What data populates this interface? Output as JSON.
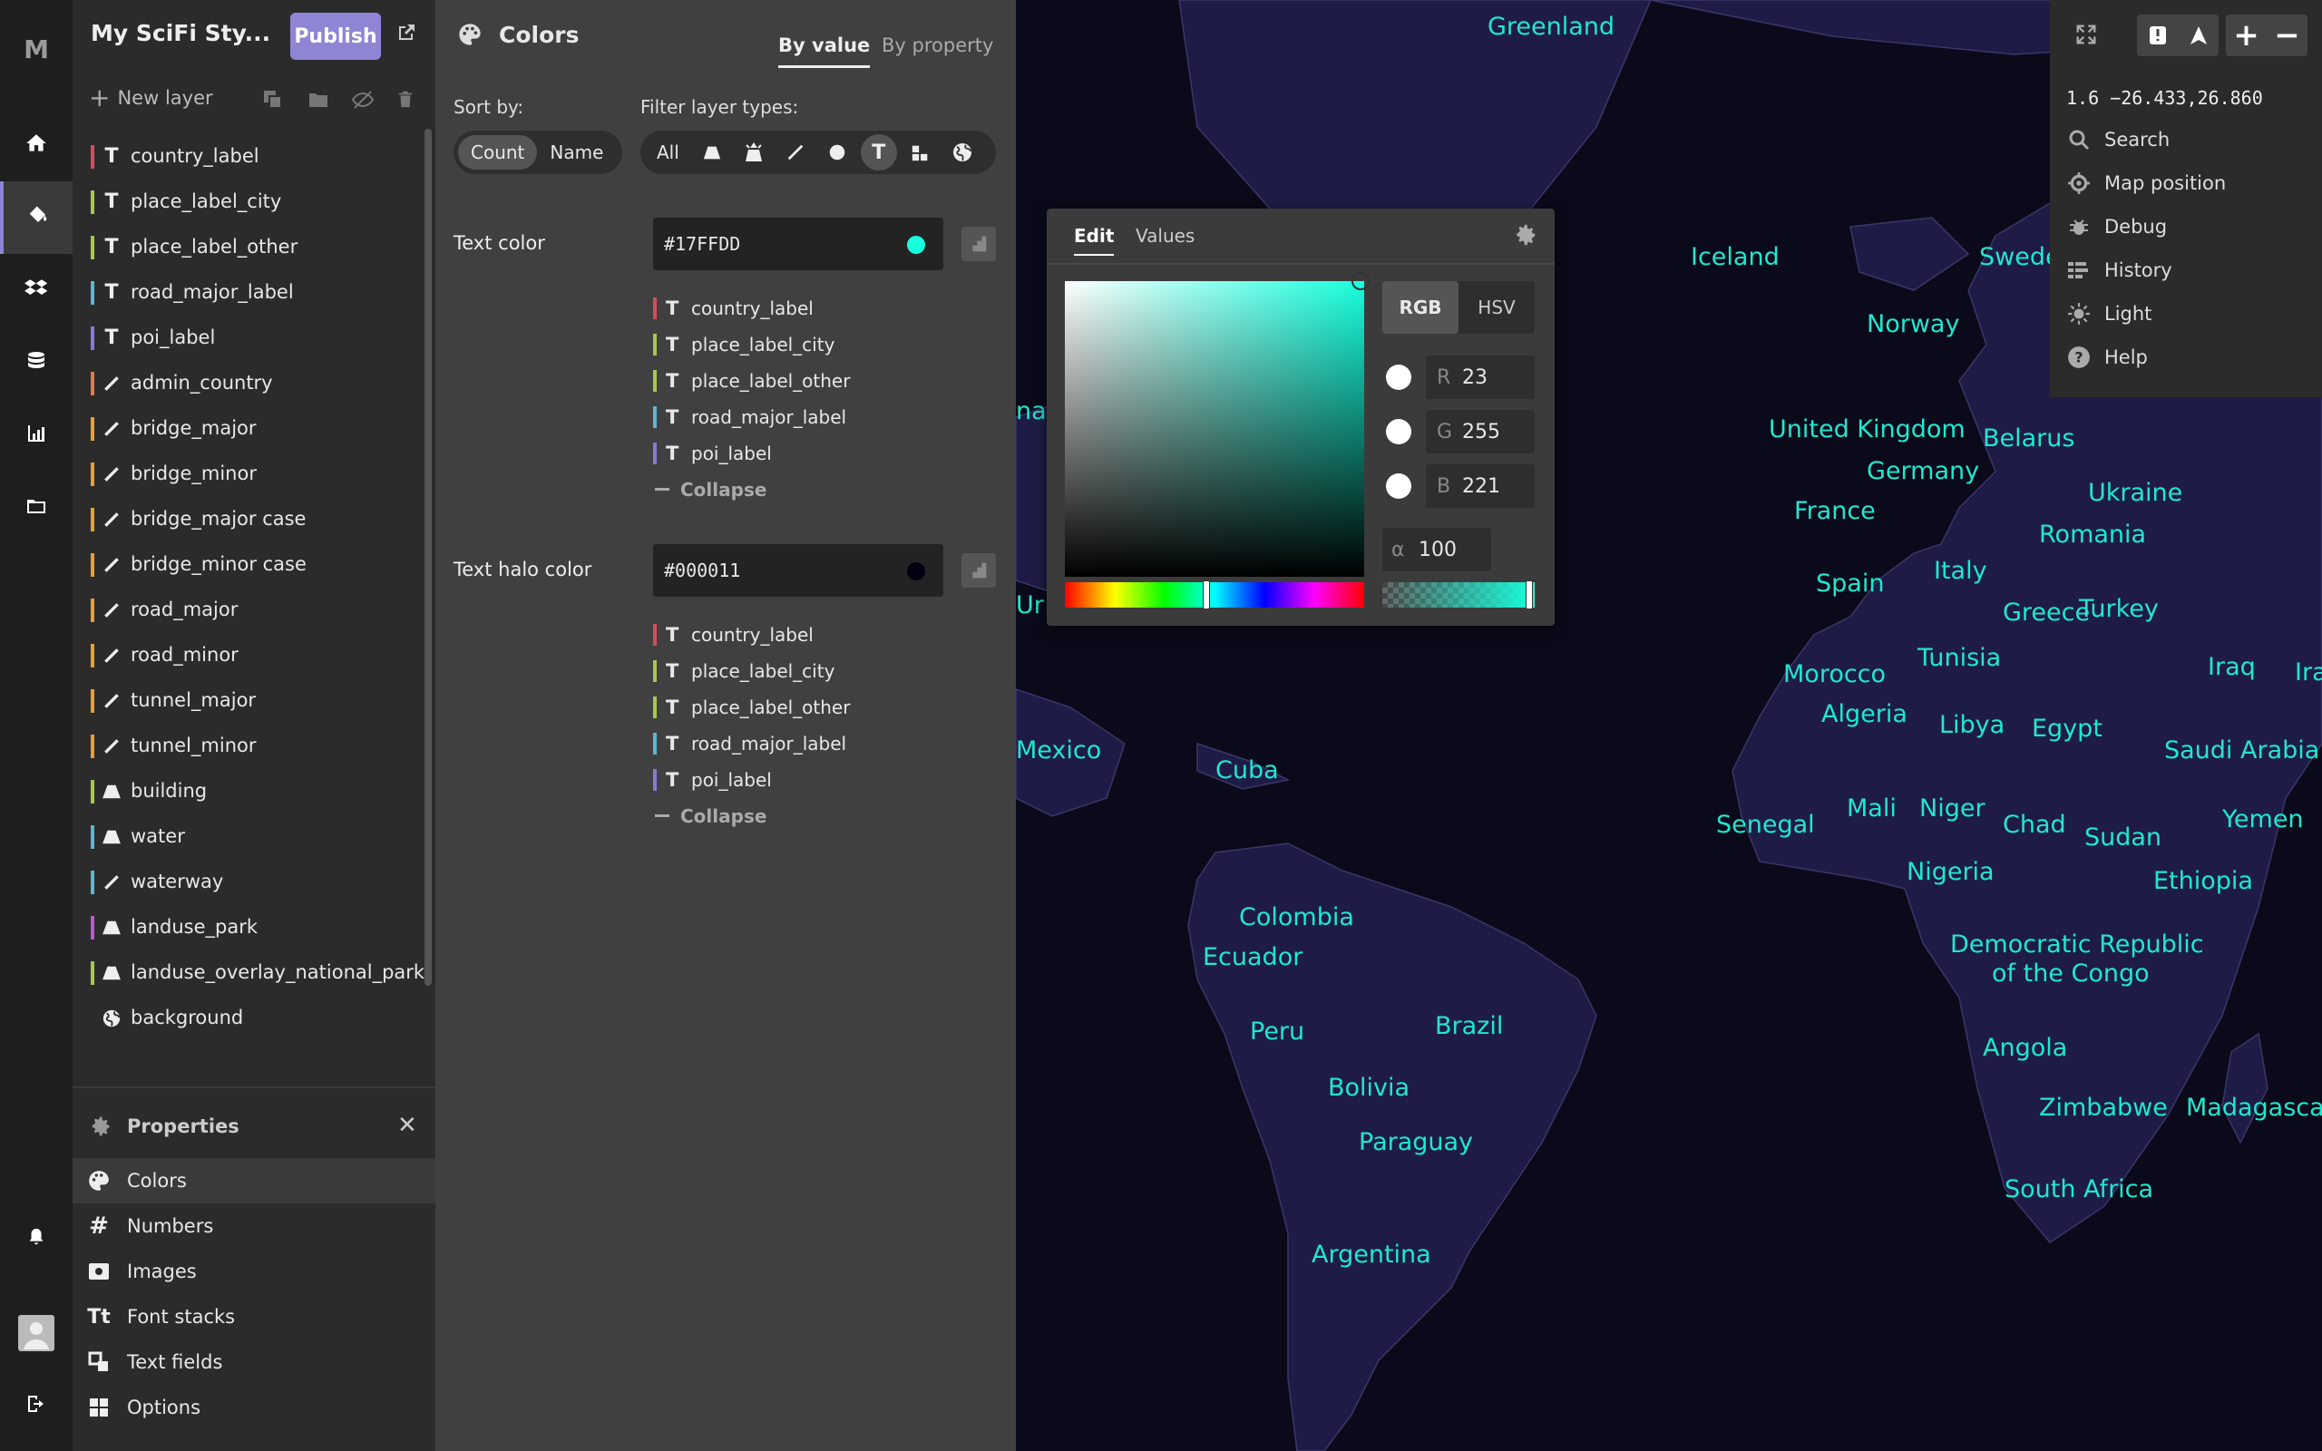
{
  "app": {
    "logo": "M"
  },
  "style": {
    "name": "My SciFi Sty...",
    "publish_label": "Publish"
  },
  "layers_toolbar": {
    "new_layer": "New layer"
  },
  "layers": [
    {
      "name": "country_label",
      "type": "symbol",
      "color": "#d94b57"
    },
    {
      "name": "place_label_city",
      "type": "symbol",
      "color": "#a8c84a"
    },
    {
      "name": "place_label_other",
      "type": "symbol",
      "color": "#a8c84a"
    },
    {
      "name": "road_major_label",
      "type": "symbol",
      "color": "#5bb6d4"
    },
    {
      "name": "poi_label",
      "type": "symbol",
      "color": "#8b78d8"
    },
    {
      "name": "admin_country",
      "type": "line",
      "color": "#e07a4a"
    },
    {
      "name": "bridge_major",
      "type": "line",
      "color": "#e8a030"
    },
    {
      "name": "bridge_minor",
      "type": "line",
      "color": "#e8a030"
    },
    {
      "name": "bridge_major case",
      "type": "line",
      "color": "#e8a030"
    },
    {
      "name": "bridge_minor case",
      "type": "line",
      "color": "#e8a030"
    },
    {
      "name": "road_major",
      "type": "line",
      "color": "#e8a030"
    },
    {
      "name": "road_minor",
      "type": "line",
      "color": "#e8a030"
    },
    {
      "name": "tunnel_major",
      "type": "line",
      "color": "#e8a030"
    },
    {
      "name": "tunnel_minor",
      "type": "line",
      "color": "#e8a030"
    },
    {
      "name": "building",
      "type": "fill",
      "color": "#a8c84a"
    },
    {
      "name": "water",
      "type": "fill",
      "color": "#5bb6d4"
    },
    {
      "name": "waterway",
      "type": "line",
      "color": "#5bb6d4"
    },
    {
      "name": "landuse_park",
      "type": "fill",
      "color": "#b45cd0"
    },
    {
      "name": "landuse_overlay_national_park",
      "type": "fill",
      "color": "#a8c84a"
    },
    {
      "name": "background",
      "type": "background",
      "color": ""
    }
  ],
  "properties": {
    "title": "Properties",
    "items": [
      "Colors",
      "Numbers",
      "Images",
      "Font stacks",
      "Text fields",
      "Options"
    ]
  },
  "colors_panel": {
    "title": "Colors",
    "tab_by_value": "By value",
    "tab_by_property": "By property",
    "sort_by_label": "Sort by:",
    "sort_count": "Count",
    "sort_name": "Name",
    "filter_label": "Filter layer types:",
    "filter_all": "All",
    "groups": [
      {
        "label": "Text color",
        "value": "#17FFDD",
        "swatch": "#17ffdd",
        "layers": [
          {
            "name": "country_label",
            "color": "#d94b57"
          },
          {
            "name": "place_label_city",
            "color": "#a8c84a"
          },
          {
            "name": "place_label_other",
            "color": "#a8c84a"
          },
          {
            "name": "road_major_label",
            "color": "#5bb6d4"
          },
          {
            "name": "poi_label",
            "color": "#8b78d8"
          }
        ],
        "collapse": "Collapse"
      },
      {
        "label": "Text halo color",
        "value": "#000011",
        "swatch": "#000011",
        "layers": [
          {
            "name": "country_label",
            "color": "#d94b57"
          },
          {
            "name": "place_label_city",
            "color": "#a8c84a"
          },
          {
            "name": "place_label_other",
            "color": "#a8c84a"
          },
          {
            "name": "road_major_label",
            "color": "#5bb6d4"
          },
          {
            "name": "poi_label",
            "color": "#8b78d8"
          }
        ],
        "collapse": "Collapse"
      }
    ]
  },
  "picker": {
    "tab_edit": "Edit",
    "tab_values": "Values",
    "mode_rgb": "RGB",
    "mode_hsv": "HSV",
    "r_label": "R",
    "r_value": "23",
    "g_label": "G",
    "g_value": "255",
    "b_label": "B",
    "b_value": "221",
    "alpha_label": "α",
    "alpha_value": "100"
  },
  "map_tools": {
    "coords": "1.6 −26.433,26.860",
    "items": [
      "Search",
      "Map position",
      "Debug",
      "History",
      "Light",
      "Help"
    ]
  },
  "map_labels": {
    "greenland": "Greenland",
    "iceland": "Iceland",
    "swede": "Swede",
    "norway": "Norway",
    "uk": "United Kingdom",
    "belarus": "Belarus",
    "germany": "Germany",
    "ukraine": "Ukraine",
    "france": "France",
    "romania": "Romania",
    "spain": "Spain",
    "italy": "Italy",
    "greece": "Greece",
    "turkey": "Turkey",
    "tunisia": "Tunisia",
    "morocco": "Morocco",
    "iraq": "Iraq",
    "ira": "Ira",
    "algeria": "Algeria",
    "libya": "Libya",
    "egypt": "Egypt",
    "saudi": "Saudi Arabia",
    "mexico": "Mexico",
    "cuba": "Cuba",
    "senegal": "Senegal",
    "mali": "Mali",
    "niger": "Niger",
    "chad": "Chad",
    "sudan": "Sudan",
    "yemen": "Yemen",
    "nigeria": "Nigeria",
    "ethiopia": "Ethiopia",
    "colombia": "Colombia",
    "ecuador": "Ecuador",
    "drc1": "Democratic Republic",
    "drc2": "of the Congo",
    "peru": "Peru",
    "brazil": "Brazil",
    "angola": "Angola",
    "bolivia": "Bolivia",
    "paraguay": "Paraguay",
    "zimbabwe": "Zimbabwe",
    "madagascar": "Madagascar",
    "south_africa": "South Africa",
    "argentina": "Argentina",
    "na": "na",
    "ur": "Ur"
  }
}
